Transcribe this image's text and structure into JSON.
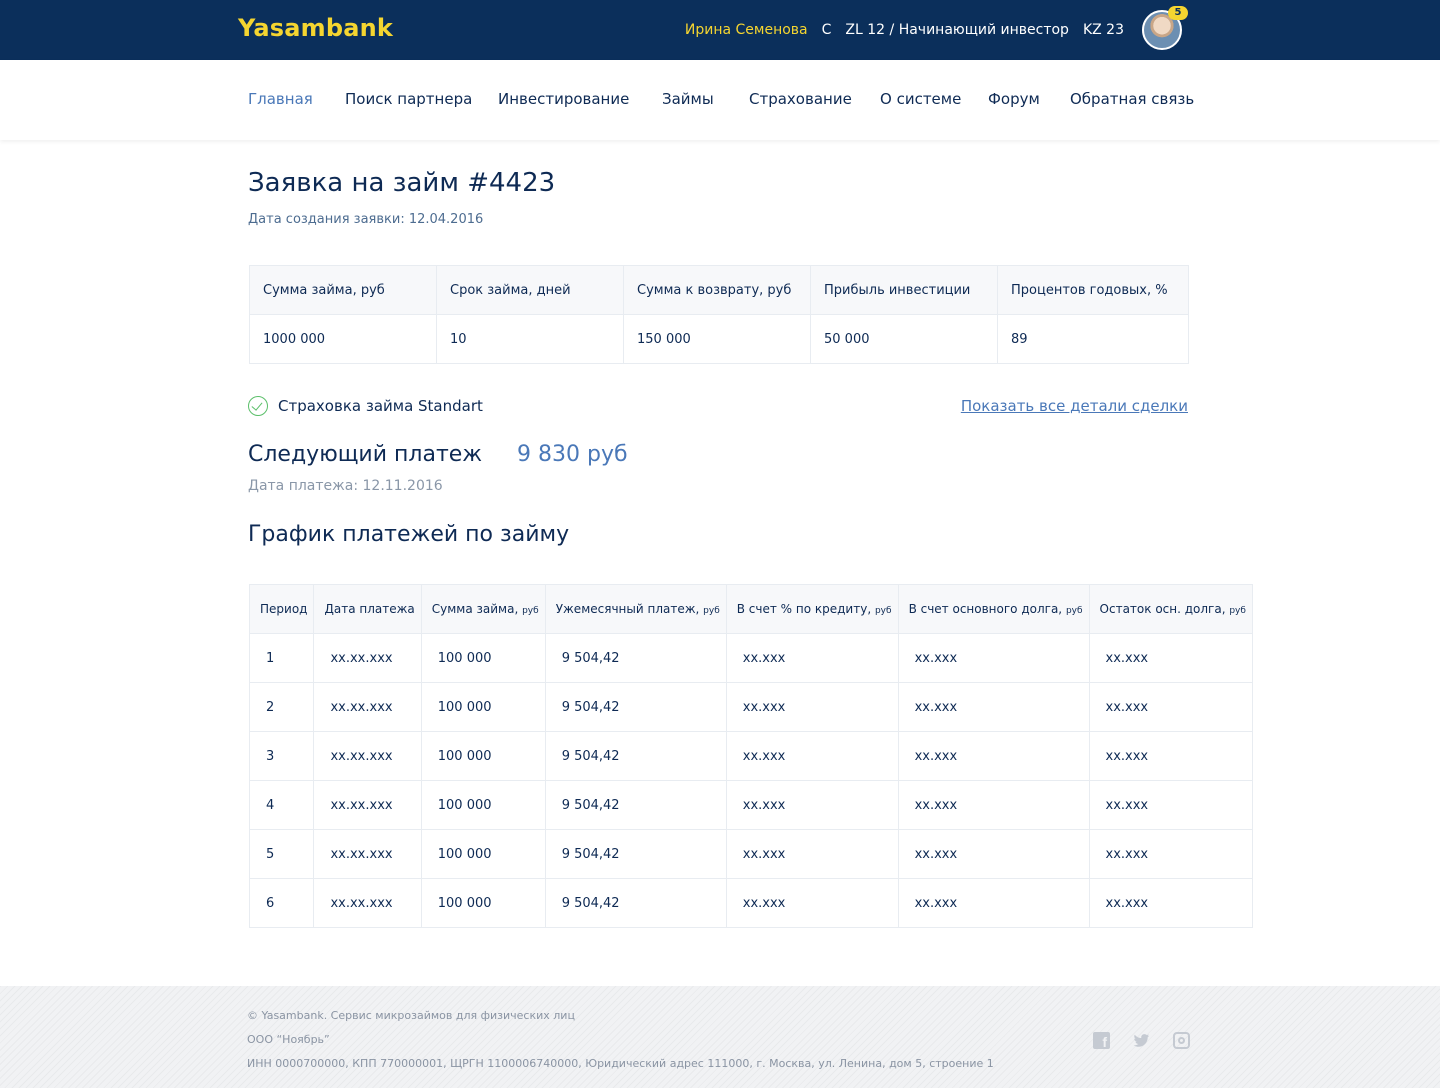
{
  "header": {
    "logo": "Yasambank",
    "user_name": "Ирина Семенова",
    "user_c": "C",
    "user_level": "ZL 12 / Начинающий инвестор",
    "user_kz": "KZ 23",
    "notifications": "5"
  },
  "nav": {
    "items": [
      {
        "label": "Главная"
      },
      {
        "label": "Поиск партнера"
      },
      {
        "label": "Инвестирование"
      },
      {
        "label": "Займы"
      },
      {
        "label": "Страхование"
      },
      {
        "label": "О системе"
      },
      {
        "label": "Форум"
      },
      {
        "label": "Обратная связь"
      }
    ]
  },
  "main": {
    "title": "Заявка на займ #4423",
    "created": "Дата создания заявки: 12.04.2016",
    "summary": {
      "headers": [
        "Сумма займа, руб",
        "Срок займа, дней",
        "Сумма к возврату, руб",
        "Прибыль инвестиции",
        "Процентов годовых, %"
      ],
      "values": [
        "1000 000",
        "10",
        "150 000",
        "50 000",
        "89"
      ]
    },
    "insurance": "Страховка займа Standart",
    "details_link": "Показать все детали сделки",
    "next_payment_label": "Следующий платеж",
    "next_payment_amount": "9 830 руб",
    "payment_date": "Дата платежа: 12.11.2016",
    "schedule_title": "График платежей по займу",
    "schedule": {
      "headers": [
        {
          "text": "Период",
          "unit": ""
        },
        {
          "text": "Дата платежа",
          "unit": ""
        },
        {
          "text": "Сумма займа, ",
          "unit": "руб"
        },
        {
          "text": "Ужемесячный платеж, ",
          "unit": "руб"
        },
        {
          "text": "В счет % по кредиту, ",
          "unit": "руб"
        },
        {
          "text": "В счет основного долга, ",
          "unit": "руб"
        },
        {
          "text": "Остаток осн. долга, ",
          "unit": "руб"
        }
      ],
      "rows": [
        [
          "1",
          "xx.xx.xxx",
          "100 000",
          "9 504,42",
          "xx.xxx",
          "xx.xxx",
          "xx.xxx"
        ],
        [
          "2",
          "xx.xx.xxx",
          "100 000",
          "9 504,42",
          "xx.xxx",
          "xx.xxx",
          "xx.xxx"
        ],
        [
          "3",
          "xx.xx.xxx",
          "100 000",
          "9 504,42",
          "xx.xxx",
          "xx.xxx",
          "xx.xxx"
        ],
        [
          "4",
          "xx.xx.xxx",
          "100 000",
          "9 504,42",
          "xx.xxx",
          "xx.xxx",
          "xx.xxx"
        ],
        [
          "5",
          "xx.xx.xxx",
          "100 000",
          "9 504,42",
          "xx.xxx",
          "xx.xxx",
          "xx.xxx"
        ],
        [
          "6",
          "xx.xx.xxx",
          "100 000",
          "9 504,42",
          "xx.xxx",
          "xx.xxx",
          "xx.xxx"
        ]
      ]
    }
  },
  "footer": {
    "copyright": "© Yasambank. Сервис микрозаймов для физических лиц",
    "company": "ООО “Ноябрь”",
    "requisites": "ИНН 0000700000, КПП 770000001, ЩРГН 1100006740000, Юридический адрес 111000, г. Москва, ул. Ленина, дом 5, строение 1",
    "social": [
      "facebook-icon",
      "twitter-icon",
      "instagram-icon"
    ]
  },
  "colors": {
    "header_bg": "#0b2f5b",
    "logo": "#f5d530",
    "accent": "#4a78b8",
    "text": "#0e2a54",
    "success": "#5bbf6a"
  }
}
